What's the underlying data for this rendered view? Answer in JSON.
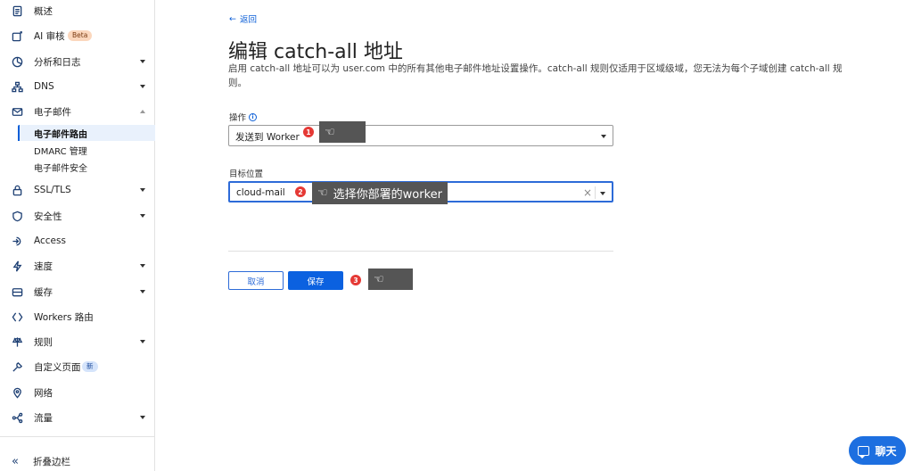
{
  "sidebar": {
    "items": [
      {
        "label": "概述",
        "icon": "document-icon"
      },
      {
        "label": "AI 审核",
        "icon": "ai-audit-icon",
        "badge": "Beta"
      },
      {
        "label": "分析和日志",
        "icon": "analytics-icon"
      },
      {
        "label": "DNS",
        "icon": "dns-icon"
      },
      {
        "label": "电子邮件",
        "icon": "email-icon"
      },
      {
        "label": "SSL/TLS",
        "icon": "lock-icon"
      },
      {
        "label": "安全性",
        "icon": "shield-icon"
      },
      {
        "label": "Access",
        "icon": "access-icon"
      },
      {
        "label": "速度",
        "icon": "bolt-icon"
      },
      {
        "label": "缓存",
        "icon": "cache-icon"
      },
      {
        "label": "Workers 路由",
        "icon": "workers-icon"
      },
      {
        "label": "规则",
        "icon": "rules-icon"
      },
      {
        "label": "自定义页面",
        "icon": "wrench-icon",
        "badge": "新"
      },
      {
        "label": "网络",
        "icon": "location-icon"
      },
      {
        "label": "流量",
        "icon": "traffic-icon"
      }
    ],
    "email_sub": [
      "电子邮件路由",
      "DMARC 管理",
      "电子邮件安全"
    ],
    "collapse_label": "折叠边栏"
  },
  "main": {
    "back_label": "返回",
    "title": "编辑 catch-all 地址",
    "description": "启用 catch-all 地址可以为 user.com 中的所有其他电子邮件地址设置操作。catch-all 规则仅适用于区域级域，您无法为每个子域创建 catch-all 规则。",
    "action_label": "操作",
    "action_value": "发送到 Worker",
    "destination_label": "目标位置",
    "destination_value": "cloud-mail",
    "cancel_label": "取消",
    "save_label": "保存"
  },
  "annotations": {
    "step1": "1",
    "step2": "2",
    "step3": "3",
    "tip2": "选择你部署的worker"
  },
  "chat_label": "聊天",
  "colors": {
    "accent": "#0b61e0",
    "step": "#e53935",
    "tooltip": "#555555"
  }
}
